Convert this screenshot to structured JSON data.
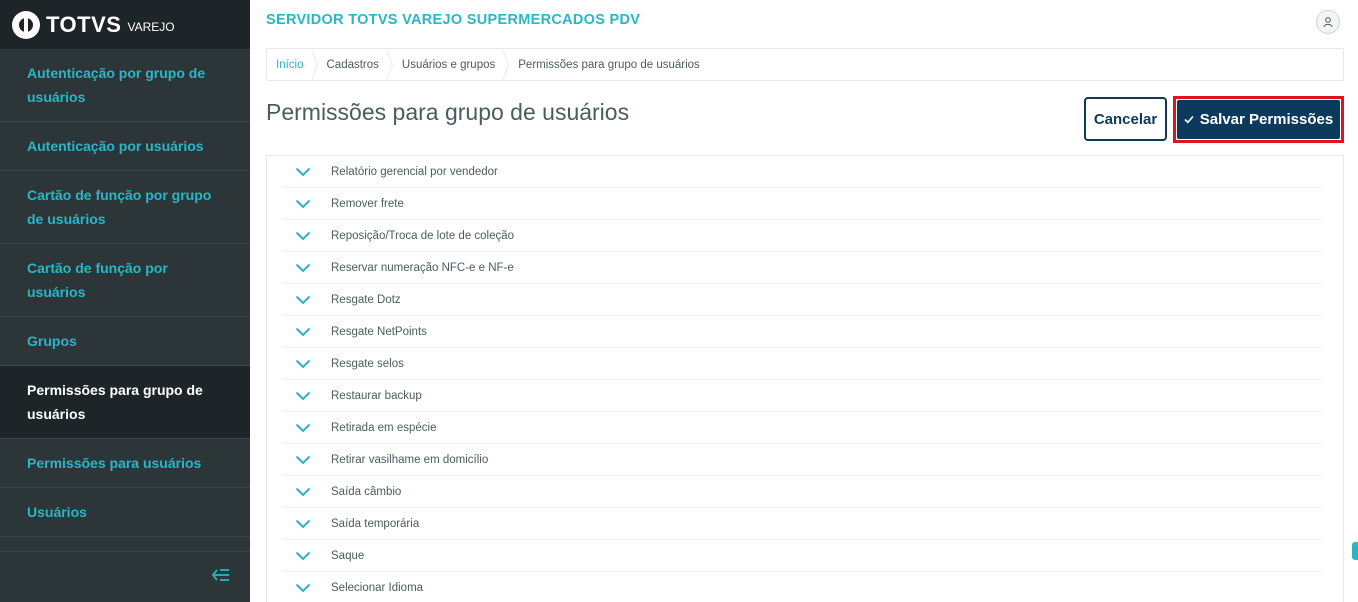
{
  "brand": {
    "name": "TOTVS",
    "sub": "VAREJO"
  },
  "header": {
    "title": "SERVIDOR TOTVS VAREJO SUPERMERCADOS PDV"
  },
  "sidebar": {
    "items": [
      {
        "label": "Autenticação por grupo de usuários",
        "active": false
      },
      {
        "label": "Autenticação por usuários",
        "active": false
      },
      {
        "label": "Cartão de função por grupo de usuários",
        "active": false
      },
      {
        "label": "Cartão de função por usuários",
        "active": false
      },
      {
        "label": "Grupos",
        "active": false
      },
      {
        "label": "Permissões para grupo de usuários",
        "active": true
      },
      {
        "label": "Permissões para usuários",
        "active": false
      },
      {
        "label": "Usuários",
        "active": false
      }
    ]
  },
  "breadcrumb": [
    "Início",
    "Cadastros",
    "Usuários e grupos",
    "Permissões para grupo de usuários"
  ],
  "page": {
    "title": "Permissões para grupo de usuários",
    "cancel_label": "Cancelar",
    "save_label": "Salvar Permissões"
  },
  "permissions": [
    "Relatório gerencial por vendedor",
    "Remover frete",
    "Reposição/Troca de lote de coleção",
    "Reservar numeração NFC-e e NF-e",
    "Resgate Dotz",
    "Resgate NetPoints",
    "Resgate selos",
    "Restaurar backup",
    "Retirada em espécie",
    "Retirar vasilhame em domicílio",
    "Saída câmbio",
    "Saída temporária",
    "Saque",
    "Selecionar Idioma"
  ],
  "colors": {
    "accent": "#29b6c5",
    "primary": "#0c3a5d",
    "highlight": "#e1141e",
    "sidebar": "#2c3639"
  },
  "icons": {
    "logo": "totvs-logo-icon",
    "user": "user-icon",
    "collapse": "collapse-menu-icon",
    "expand": "chevron-down-icon",
    "check": "check-icon"
  }
}
